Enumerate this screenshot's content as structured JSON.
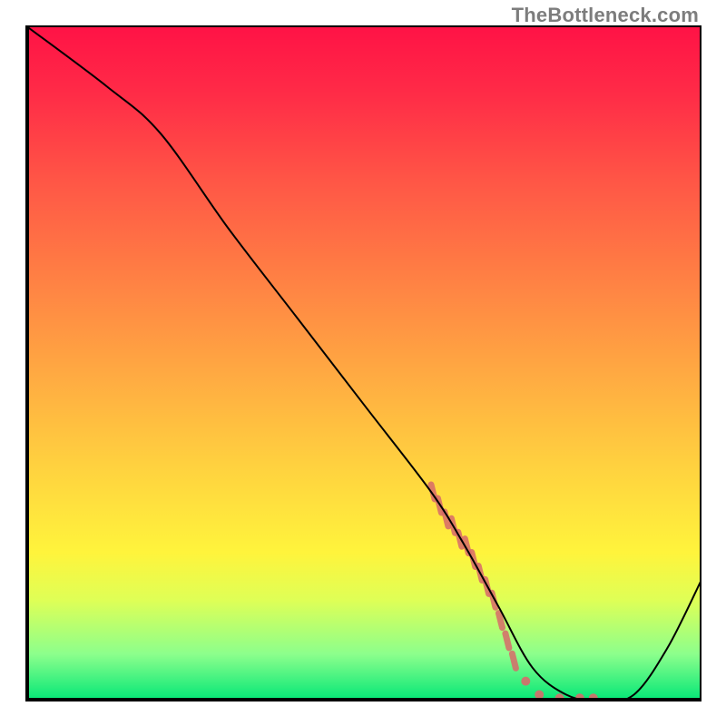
{
  "watermark": "TheBottleneck.com",
  "chart_data": {
    "type": "line",
    "title": "",
    "xlabel": "",
    "ylabel": "",
    "xlim": [
      0,
      100
    ],
    "ylim": [
      0,
      100
    ],
    "grid": false,
    "legend": false,
    "background_gradient": {
      "direction": "vertical",
      "stops": [
        {
          "pos": 0,
          "color": "#ff1246"
        },
        {
          "pos": 10,
          "color": "#ff2b47"
        },
        {
          "pos": 23,
          "color": "#ff5646"
        },
        {
          "pos": 37,
          "color": "#ff7f44"
        },
        {
          "pos": 51,
          "color": "#ffa842"
        },
        {
          "pos": 65,
          "color": "#ffd13f"
        },
        {
          "pos": 78,
          "color": "#fff43c"
        },
        {
          "pos": 85,
          "color": "#dfff56"
        },
        {
          "pos": 93,
          "color": "#8cff8c"
        },
        {
          "pos": 100,
          "color": "#00e676"
        }
      ]
    },
    "series": [
      {
        "name": "bottleneck-curve",
        "color": "#000000",
        "stroke_width": 2,
        "x": [
          0,
          12,
          20,
          30,
          40,
          50,
          60,
          65,
          70,
          75,
          80,
          85,
          90,
          95,
          100
        ],
        "values": [
          100,
          91,
          84,
          70,
          57,
          44,
          31,
          23,
          14,
          5,
          1,
          0,
          1,
          8,
          18
        ]
      }
    ],
    "scatter": {
      "name": "highlight-points",
      "color": "#d86a6a",
      "x": [
        60,
        61,
        62,
        63,
        64,
        65,
        66,
        67,
        68,
        69,
        70,
        71,
        72,
        74,
        76,
        79,
        82,
        84
      ],
      "values": [
        31,
        29,
        27,
        26,
        24,
        23,
        21,
        19,
        17,
        15,
        12,
        9,
        6,
        3,
        1,
        0.5,
        0.5,
        0.5
      ]
    }
  }
}
